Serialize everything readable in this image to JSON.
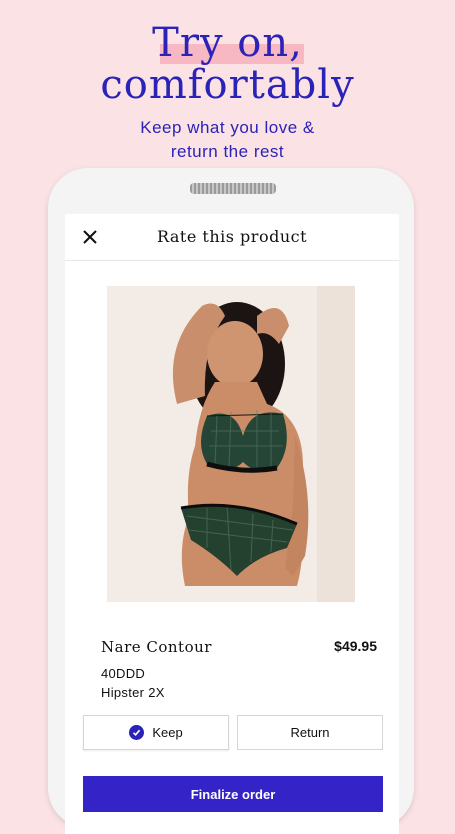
{
  "hero": {
    "title_line1": "Try on,",
    "title_line2": "comfortably",
    "subtitle_line1": "Keep what you love &",
    "subtitle_line2": "return the rest"
  },
  "screen": {
    "title": "Rate this product",
    "close_icon": "close-icon",
    "product": {
      "name": "Nare Contour",
      "price": "$49.95",
      "variant1": "40DDD",
      "variant2": "Hipster 2X"
    },
    "keep_label": "Keep",
    "return_label": "Return",
    "finalize_label": "Finalize order"
  },
  "colors": {
    "background": "#fbe2e4",
    "accent": "#2b23b8",
    "highlight": "#f7b8c3",
    "button": "#3424c8"
  }
}
